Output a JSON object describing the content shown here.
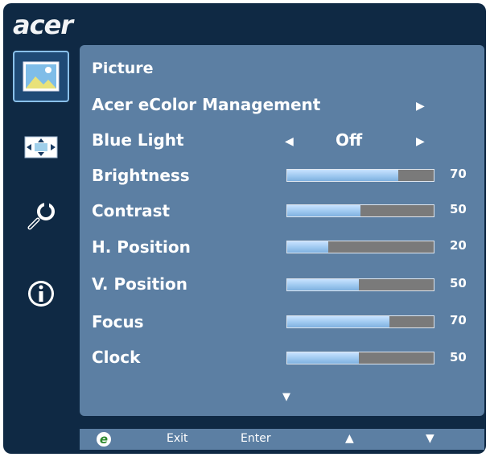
{
  "brand": "acer",
  "sidebar": {
    "items": [
      {
        "name": "picture-icon",
        "active": true
      },
      {
        "name": "position-icon",
        "active": false
      },
      {
        "name": "settings-icon",
        "active": false
      },
      {
        "name": "info-icon",
        "active": false
      }
    ]
  },
  "menu": {
    "section_title": "Picture",
    "ecolor": {
      "label": "Acer eColor Management"
    },
    "bluelight": {
      "label": "Blue Light",
      "value": "Off"
    },
    "sliders": [
      {
        "label": "Brightness",
        "value": 70
      },
      {
        "label": "Contrast",
        "value": 50
      },
      {
        "label": "H. Position",
        "value": 20
      },
      {
        "label": "V. Position",
        "value": 50
      },
      {
        "label": "Focus",
        "value": 70
      },
      {
        "label": "Clock",
        "value": 50
      }
    ],
    "sliders_fill_fraction": [
      0.76,
      0.5,
      0.28,
      0.49,
      0.7,
      0.49
    ],
    "scroll_down_icon": "triangle-down-icon"
  },
  "footer": {
    "exit_label": "Exit",
    "enter_label": "Enter",
    "up_icon": "triangle-up-icon",
    "down_icon": "triangle-down-icon",
    "eco_icon": "e-logo-icon"
  },
  "colors": {
    "osd_background": "#0f2944",
    "panel": "#5c7fa3",
    "bar_fill": "#9ec8f0",
    "bar_track": "#7a7a7a"
  }
}
